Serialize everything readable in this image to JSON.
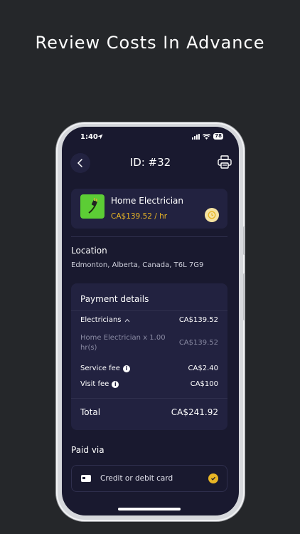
{
  "headline": "Review Costs In Advance",
  "status": {
    "time": "1:40",
    "battery": "78"
  },
  "header": {
    "title": "ID: #32"
  },
  "service": {
    "name": "Home Electrician",
    "price": "CA$139.52 / hr"
  },
  "location": {
    "title": "Location",
    "address": "Edmonton, Alberta, Canada, T6L 7G9"
  },
  "payment": {
    "title": "Payment details",
    "electricians_label": "Electricians",
    "electricians_value": "CA$139.52",
    "line_item_label": "Home Electrician x 1.00 hr(s)",
    "line_item_value": "CA$139.52",
    "service_fee_label": "Service fee",
    "service_fee_value": "CA$2.40",
    "visit_fee_label": "Visit fee",
    "visit_fee_value": "CA$100",
    "total_label": "Total",
    "total_value": "CA$241.92"
  },
  "paid_via": {
    "title": "Paid via",
    "method": "Credit or debit card"
  },
  "icons": {
    "back": "chevron-left-icon",
    "print": "printer-icon",
    "clock": "clock-icon",
    "info": "info-icon",
    "card": "credit-card-icon",
    "check": "check-circle-icon"
  },
  "colors": {
    "accent": "#e8b525",
    "service_green": "#5ccd35",
    "screen_bg": "#19192f",
    "card_bg": "#222240"
  }
}
